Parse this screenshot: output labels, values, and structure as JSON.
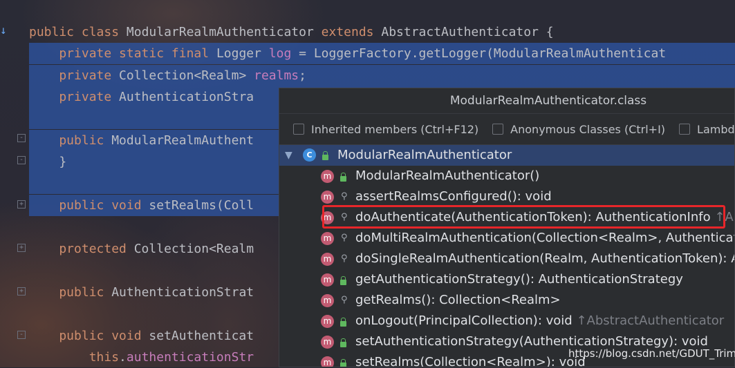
{
  "editor": {
    "code_lines": [
      {
        "parts": [
          {
            "t": "public class ",
            "c": "kw"
          },
          {
            "t": "ModularRealmAuthenticator ",
            "c": "plain"
          },
          {
            "t": "extends ",
            "c": "kw"
          },
          {
            "t": "AbstractAuthenticator {",
            "c": "plain"
          }
        ]
      },
      {
        "parts": [
          {
            "t": "    private static final ",
            "c": "kw"
          },
          {
            "t": "Logger ",
            "c": "plain"
          },
          {
            "t": "log",
            "c": "field"
          },
          {
            "t": " = LoggerFactory.getLogger(ModularRealmAuthenticat",
            "c": "plain"
          }
        ]
      },
      {
        "parts": [
          {
            "t": "    private ",
            "c": "kw"
          },
          {
            "t": "Collection<Realm> ",
            "c": "plain"
          },
          {
            "t": "realms",
            "c": "field"
          },
          {
            "t": ";",
            "c": "plain"
          }
        ]
      },
      {
        "parts": [
          {
            "t": "    private ",
            "c": "kw"
          },
          {
            "t": "AuthenticationStra",
            "c": "plain"
          }
        ]
      },
      {
        "parts": []
      },
      {
        "parts": [
          {
            "t": "    public ",
            "c": "kw"
          },
          {
            "t": "ModularRealmAuthent",
            "c": "plain"
          }
        ]
      },
      {
        "parts": [
          {
            "t": "    }",
            "c": "plain"
          }
        ]
      },
      {
        "parts": []
      },
      {
        "parts": [
          {
            "t": "    public void ",
            "c": "kw"
          },
          {
            "t": "setRealms(Coll",
            "c": "plain"
          }
        ]
      },
      {
        "parts": []
      },
      {
        "parts": [
          {
            "t": "    protected ",
            "c": "kw"
          },
          {
            "t": "Collection<Realm",
            "c": "plain"
          }
        ]
      },
      {
        "parts": []
      },
      {
        "parts": [
          {
            "t": "    public ",
            "c": "kw"
          },
          {
            "t": "AuthenticationStrat",
            "c": "plain"
          }
        ]
      },
      {
        "parts": []
      },
      {
        "parts": [
          {
            "t": "    public void ",
            "c": "kw"
          },
          {
            "t": "setAuthenticat",
            "c": "plain"
          }
        ]
      },
      {
        "parts": [
          {
            "t": "        this",
            "c": "kw"
          },
          {
            "t": ".",
            "c": "plain"
          },
          {
            "t": "authenticationStr",
            "c": "field"
          }
        ]
      }
    ]
  },
  "popup": {
    "title": "ModularRealmAuthenticator.class",
    "filters": [
      "Inherited members (Ctrl+F12)",
      "Anonymous Classes (Ctrl+I)",
      "Lambda"
    ],
    "root": {
      "icon_letter": "C",
      "label": "ModularRealmAuthenticator"
    },
    "members": [
      {
        "label": "ModularRealmAuthenticator()",
        "inherited": "",
        "access": "public"
      },
      {
        "label": "assertRealmsConfigured(): void",
        "inherited": "",
        "access": "protected"
      },
      {
        "label": "doAuthenticate(AuthenticationToken): AuthenticationInfo ",
        "inherited": "↑Abst",
        "access": "protected"
      },
      {
        "label": "doMultiRealmAuthentication(Collection<Realm>, Authenticatio",
        "inherited": "",
        "access": "protected"
      },
      {
        "label": "doSingleRealmAuthentication(Realm, AuthenticationToken): Aut",
        "inherited": "",
        "access": "protected"
      },
      {
        "label": "getAuthenticationStrategy(): AuthenticationStrategy",
        "inherited": "",
        "access": "public"
      },
      {
        "label": "getRealms(): Collection<Realm>",
        "inherited": "",
        "access": "protected"
      },
      {
        "label": "onLogout(PrincipalCollection): void ",
        "inherited": "↑AbstractAuthenticator",
        "access": "public"
      },
      {
        "label": "setAuthenticationStrategy(AuthenticationStrategy): void",
        "inherited": "",
        "access": "public"
      },
      {
        "label": "setRealms(Collection<Realm>): void",
        "inherited": "",
        "access": "public"
      }
    ],
    "member_icon_letter": "m"
  },
  "watermark": "https://blog.csdn.net/GDUT_Trim",
  "colors": {
    "selection": "#2d53a0",
    "keyword": "#cf8e6d",
    "field": "#c77dbb",
    "highlight": "#e8262a"
  }
}
